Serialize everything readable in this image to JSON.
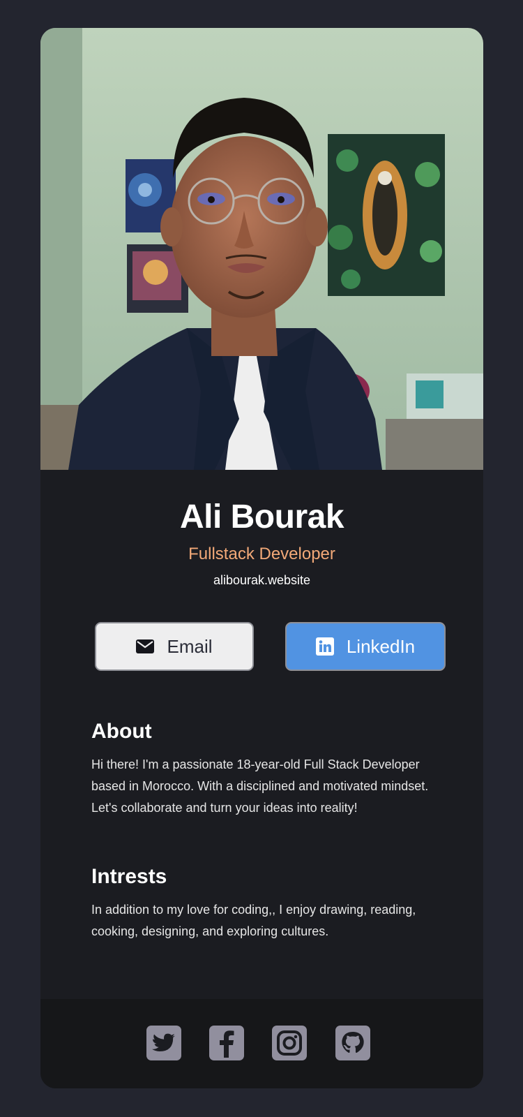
{
  "profile": {
    "name": "Ali Bourak",
    "role": "Fullstack Developer",
    "website": "alibourak.website"
  },
  "buttons": {
    "email_label": "Email",
    "email_icon": "envelope-icon",
    "linkedin_label": "LinkedIn",
    "linkedin_icon": "linkedin-icon"
  },
  "about": {
    "heading": "About",
    "text": "Hi there! I'm a passionate 18-year-old Full Stack Developer based in Morocco. With a disciplined and motivated mindset. Let's collaborate and turn your ideas into reality!"
  },
  "interests": {
    "heading": "Intrests",
    "text": "In addition to my love for coding,, I enjoy drawing, reading, cooking, designing, and exploring cultures."
  },
  "social": [
    "twitter-icon",
    "facebook-icon",
    "instagram-icon",
    "github-icon"
  ],
  "colors": {
    "page_bg": "#23252f",
    "card_bg": "#1b1c21",
    "footer_bg": "#161719",
    "role_accent": "#f2a978",
    "linkedin_blue": "#5193e2",
    "email_button_bg": "#eeeeef",
    "social_icon_bg": "#918f9e"
  }
}
